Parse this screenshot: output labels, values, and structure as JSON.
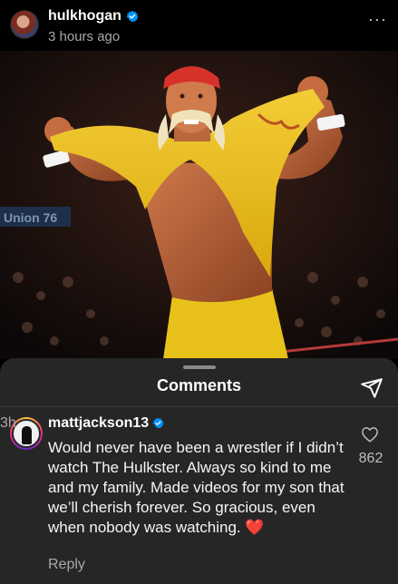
{
  "post": {
    "username": "hulkhogan",
    "time": "3 hours ago",
    "more_label": "···"
  },
  "photo": {
    "banner_text": "Union 76"
  },
  "comments_sheet": {
    "title": "Comments",
    "comment": {
      "username": "mattjackson13",
      "time": "3h",
      "text": "Would never have been a wrestler if I didn’t watch The Hulkster. Always so kind to me and my family. Made videos for my son that we’ll cherish forever. So gracious, even when nobody was watching.",
      "emoji": "❤️",
      "likes": "862",
      "reply_label": "Reply"
    }
  },
  "colors": {
    "background": "#000000",
    "sheet": "#262626",
    "verified": "#0095f6",
    "muted_text": "#a8a8a8",
    "tank_top": "#f0c21c",
    "headband": "#d6322b"
  },
  "icons": [
    "verified-badge-icon",
    "more-options-icon",
    "share-icon",
    "heart-outline-icon"
  ]
}
